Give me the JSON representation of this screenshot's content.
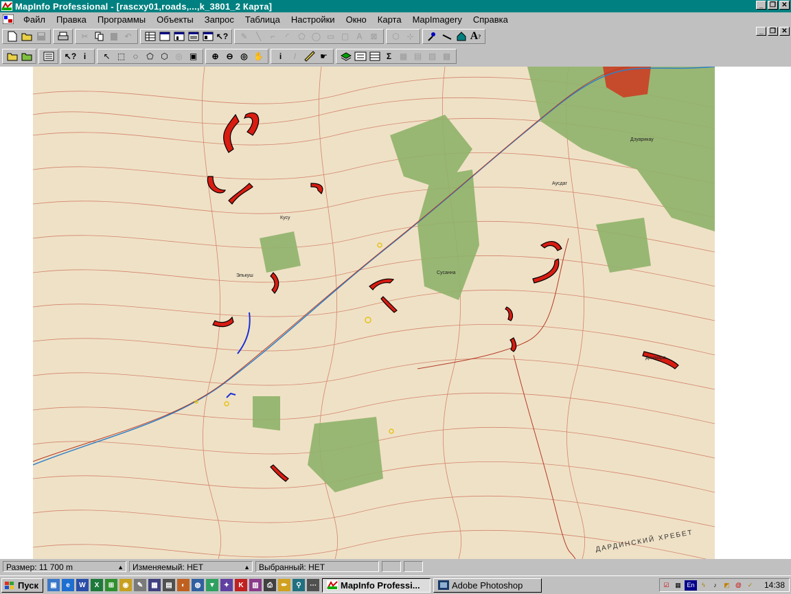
{
  "window": {
    "title": "MapInfo Professional - [rascxy01,roads,...,k_3801_2 Карта]",
    "minimize": "_",
    "restore": "❐",
    "close": "✕"
  },
  "menu": [
    {
      "label": "Файл"
    },
    {
      "label": "Правка"
    },
    {
      "label": "Программы"
    },
    {
      "label": "Объекты"
    },
    {
      "label": "Запрос"
    },
    {
      "label": "Таблица"
    },
    {
      "label": "Настройки"
    },
    {
      "label": "Окно"
    },
    {
      "label": "Карта"
    },
    {
      "label": "MapImagery"
    },
    {
      "label": "Справка"
    }
  ],
  "map": {
    "labels": [
      "Элькуш",
      "Аусдаг",
      "Дзуарикау",
      "Сусанна",
      "Кусу",
      "Джимара"
    ],
    "ridge_label": "ДАРДИНСКИЙ ХРЕБЕТ",
    "colors": {
      "background": "#efe1c6",
      "contours": "#c8664e",
      "forest": "#8fb36a",
      "landslide_fill": "#d81c12",
      "river": "#2e7fc7",
      "blue_feature": "#1a2fd6"
    }
  },
  "status": {
    "size": "Размер: 11 700 m",
    "editable": "Изменяемый: НЕТ",
    "selected": "Выбранный: НЕТ"
  },
  "taskbar": {
    "start": "Пуск",
    "tasks": [
      {
        "label": "MapInfo Professi..."
      },
      {
        "label": "Adobe Photoshop"
      }
    ],
    "tray_lang": "En",
    "clock": "14:38"
  }
}
